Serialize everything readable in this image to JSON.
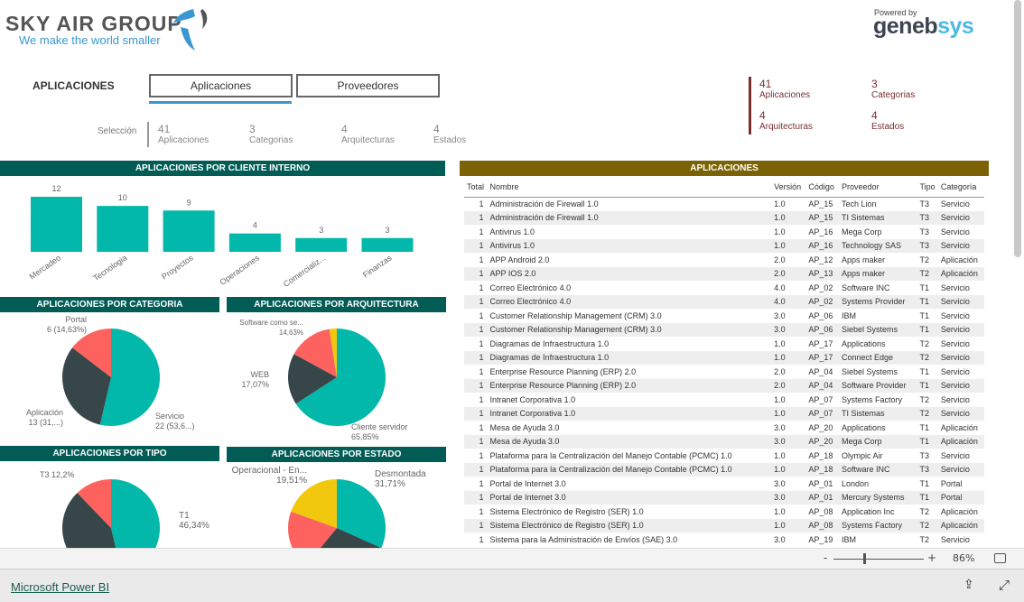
{
  "header": {
    "logo_name": "SKY AIR GROUP",
    "logo_tagline": "We make the world smaller",
    "powered_by": "Powered by",
    "powered_brand_a": "geneb",
    "powered_brand_b": "sys",
    "page_title": "APLICACIONES"
  },
  "tabs": [
    {
      "label": "Aplicaciones",
      "active": true
    },
    {
      "label": "Proveedores",
      "active": false
    }
  ],
  "selection": {
    "label": "Selección",
    "kpis": [
      {
        "value": "41",
        "label": "Aplicaciones"
      },
      {
        "value": "3",
        "label": "Categorias"
      },
      {
        "value": "4",
        "label": "Arquitecturas"
      },
      {
        "value": "4",
        "label": "Estados"
      }
    ]
  },
  "totals": {
    "kpis": [
      {
        "value": "41",
        "label": "Aplicaciones"
      },
      {
        "value": "3",
        "label": "Categorias"
      },
      {
        "value": "4",
        "label": "Arquitecturas"
      },
      {
        "value": "4",
        "label": "Estados"
      }
    ]
  },
  "colors": {
    "teal": "#01b8aa",
    "dark": "#374649",
    "red": "#fd625e",
    "yellow": "#f2c80f",
    "header": "#015c55",
    "table_header": "#7a6205"
  },
  "chart_data": [
    {
      "type": "bar",
      "title": "APLICACIONES POR CLIENTE INTERNO",
      "categories": [
        "Mercadeo",
        "Tecnologia",
        "Proyectos",
        "Operaciones",
        "Comercializ...",
        "Finanzas"
      ],
      "values": [
        12,
        10,
        9,
        4,
        3,
        3
      ]
    },
    {
      "type": "pie",
      "title": "APLICACIONES POR CATEGORIA",
      "slices": [
        {
          "name": "Servicio",
          "value": 22,
          "label": "Servicio",
          "sub": "22 (53,6...)",
          "color": "#01b8aa"
        },
        {
          "name": "Aplicación",
          "value": 13,
          "label": "Aplicación",
          "sub": "13 (31,...)",
          "color": "#374649"
        },
        {
          "name": "Portal",
          "value": 6,
          "label": "Portal",
          "sub": "6 (14,63%)",
          "color": "#fd625e"
        }
      ]
    },
    {
      "type": "pie",
      "title": "APLICACIONES POR ARQUITECTURA",
      "slices": [
        {
          "name": "Cliente servidor",
          "value": 65.85,
          "label": "Cliente servidor",
          "sub": "65,85%",
          "color": "#01b8aa"
        },
        {
          "name": "WEB",
          "value": 17.07,
          "label": "WEB",
          "sub": "17,07%",
          "color": "#374649"
        },
        {
          "name": "Software como se...",
          "value": 14.63,
          "label": "Software como se...",
          "sub": "14,63%",
          "color": "#fd625e"
        },
        {
          "value": 2.44,
          "color": "#f2c80f"
        }
      ]
    },
    {
      "type": "pie",
      "title": "APLICACIONES POR TIPO",
      "slices": [
        {
          "name": "T1",
          "value": 46.34,
          "label": "T1",
          "sub": "46,34%",
          "color": "#01b8aa"
        },
        {
          "value": 41.46,
          "color": "#374649"
        },
        {
          "name": "T3",
          "value": 12.2,
          "label": "T3 12,2%",
          "color": "#fd625e"
        }
      ]
    },
    {
      "type": "pie",
      "title": "APLICACIONES POR ESTADO",
      "slices": [
        {
          "name": "Desmontada",
          "value": 31.71,
          "label": "Desmontada",
          "sub": "31,71%",
          "color": "#01b8aa"
        },
        {
          "value": 29.27,
          "color": "#374649"
        },
        {
          "value": 19.51,
          "color": "#fd625e"
        },
        {
          "name": "Operacional - En...",
          "value": 19.51,
          "label": "Operacional - En...",
          "sub": "19,51%",
          "color": "#f2c80f"
        }
      ]
    }
  ],
  "table": {
    "title": "APLICACIONES",
    "columns": [
      "Total",
      "Nombre",
      "Versión",
      "Código",
      "Proveedor",
      "Tipo",
      "Categoría"
    ],
    "rows": [
      [
        "1",
        "Administración de Firewall 1.0",
        "1.0",
        "AP_15",
        "Tech Lion",
        "T3",
        "Servicio"
      ],
      [
        "1",
        "Administración de Firewall 1.0",
        "1.0",
        "AP_15",
        "TI Sistemas",
        "T3",
        "Servicio"
      ],
      [
        "1",
        "Antivirus 1.0",
        "1.0",
        "AP_16",
        "Mega Corp",
        "T3",
        "Servicio"
      ],
      [
        "1",
        "Antivirus 1.0",
        "1.0",
        "AP_16",
        "Technology SAS",
        "T3",
        "Servicio"
      ],
      [
        "1",
        "APP Android 2.0",
        "2.0",
        "AP_12",
        "Apps maker",
        "T2",
        "Aplicación"
      ],
      [
        "1",
        "APP IOS 2.0",
        "2.0",
        "AP_13",
        "Apps maker",
        "T2",
        "Aplicación"
      ],
      [
        "1",
        "Correo Electrónico 4.0",
        "4.0",
        "AP_02",
        "Software INC",
        "T1",
        "Servicio"
      ],
      [
        "1",
        "Correo Electrónico 4.0",
        "4.0",
        "AP_02",
        "Systems Provider",
        "T1",
        "Servicio"
      ],
      [
        "1",
        "Customer Relationship Management (CRM) 3.0",
        "3.0",
        "AP_06",
        "IBM",
        "T1",
        "Servicio"
      ],
      [
        "1",
        "Customer Relationship Management (CRM) 3.0",
        "3.0",
        "AP_06",
        "Siebel Systems",
        "T1",
        "Servicio"
      ],
      [
        "1",
        "Diagramas de Infraestructura 1.0",
        "1.0",
        "AP_17",
        "Applications",
        "T2",
        "Servicio"
      ],
      [
        "1",
        "Diagramas de Infraestructura 1.0",
        "1.0",
        "AP_17",
        "Connect Edge",
        "T2",
        "Servicio"
      ],
      [
        "1",
        "Enterprise Resource Planning (ERP) 2.0",
        "2.0",
        "AP_04",
        "Siebel Systems",
        "T1",
        "Servicio"
      ],
      [
        "1",
        "Enterprise Resource Planning (ERP) 2.0",
        "2.0",
        "AP_04",
        "Software Provider",
        "T1",
        "Servicio"
      ],
      [
        "1",
        "Intranet Corporativa 1.0",
        "1.0",
        "AP_07",
        "Systems Factory",
        "T2",
        "Servicio"
      ],
      [
        "1",
        "Intranet Corporativa 1.0",
        "1.0",
        "AP_07",
        "TI Sistemas",
        "T2",
        "Servicio"
      ],
      [
        "1",
        "Mesa de Ayuda 3.0",
        "3.0",
        "AP_20",
        "Applications",
        "T1",
        "Aplicación"
      ],
      [
        "1",
        "Mesa de Ayuda 3.0",
        "3.0",
        "AP_20",
        "Mega Corp",
        "T1",
        "Aplicación"
      ],
      [
        "1",
        "Plataforma para la Centralización del Manejo Contable (PCMC) 1.0",
        "1.0",
        "AP_18",
        "Olympic Air",
        "T3",
        "Servicio"
      ],
      [
        "1",
        "Plataforma para la Centralización del Manejo Contable (PCMC) 1.0",
        "1.0",
        "AP_18",
        "Software INC",
        "T3",
        "Servicio"
      ],
      [
        "1",
        "Portal de Internet 3.0",
        "3.0",
        "AP_01",
        "London",
        "T1",
        "Portal"
      ],
      [
        "1",
        "Portal de Internet 3.0",
        "3.0",
        "AP_01",
        "Mercury Systems",
        "T1",
        "Portal"
      ],
      [
        "1",
        "Sistema Electrónico de Registro (SER) 1.0",
        "1.0",
        "AP_08",
        "Application Inc",
        "T2",
        "Aplicación"
      ],
      [
        "1",
        "Sistema Electrónico de Registro (SER) 1.0",
        "1.0",
        "AP_08",
        "Systems Factory",
        "T2",
        "Aplicación"
      ],
      [
        "1",
        "Sistema para la Administración de Envíos (SAE) 3.0",
        "3.0",
        "AP_19",
        "IBM",
        "T2",
        "Servicio"
      ]
    ]
  },
  "toolbar": {
    "zoom_minus": "-",
    "zoom_plus": "+",
    "zoom_level": "86%",
    "zoom_value_percent": 86
  },
  "footer": {
    "link": "Microsoft Power BI"
  }
}
